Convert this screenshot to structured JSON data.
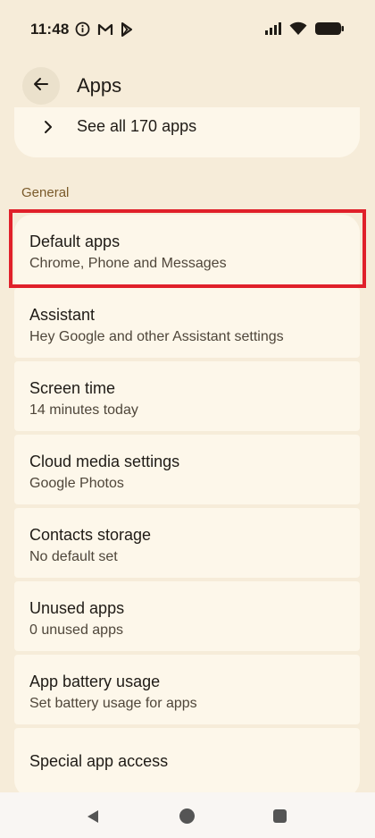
{
  "status_bar": {
    "time": "11:48",
    "icons_left": [
      "info-circle-icon",
      "gmail-icon",
      "play-store-icon"
    ],
    "icons_right": [
      "cellular-signal-icon",
      "wifi-icon",
      "battery-icon"
    ]
  },
  "app_bar": {
    "title": "Apps",
    "back_icon": "arrow-back-icon"
  },
  "see_all": {
    "label": "See all 170 apps",
    "icon": "chevron-right-icon"
  },
  "section": {
    "title": "General"
  },
  "items": [
    {
      "title": "Default apps",
      "subtitle": "Chrome, Phone and Messages",
      "highlighted": true
    },
    {
      "title": "Assistant",
      "subtitle": "Hey Google and other Assistant settings"
    },
    {
      "title": "Screen time",
      "subtitle": "14 minutes today"
    },
    {
      "title": "Cloud media settings",
      "subtitle": "Google Photos"
    },
    {
      "title": "Contacts storage",
      "subtitle": "No default set"
    },
    {
      "title": "Unused apps",
      "subtitle": "0 unused apps"
    },
    {
      "title": "App battery usage",
      "subtitle": "Set battery usage for apps"
    },
    {
      "title": "Special app access"
    }
  ],
  "colors": {
    "background": "#f6ecd9",
    "card": "#fdf7ea",
    "accent_text": "#7a5a2a",
    "highlight": "#e0202a"
  },
  "nav_bar": {
    "icons": [
      "nav-back-icon",
      "nav-home-icon",
      "nav-recents-icon"
    ]
  }
}
